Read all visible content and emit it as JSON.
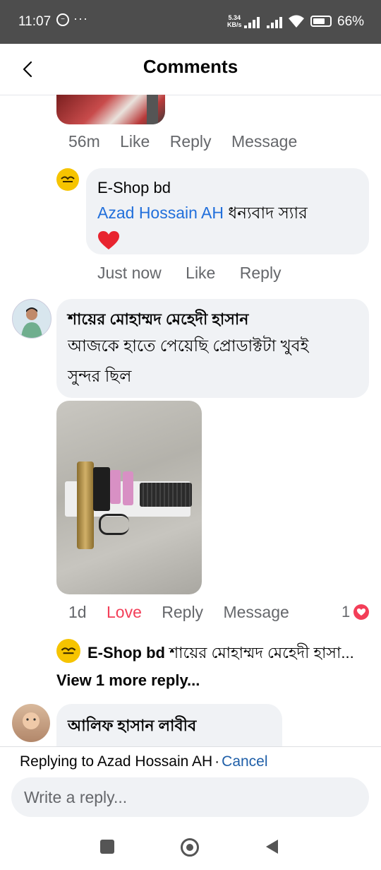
{
  "status_bar": {
    "time": "11:07",
    "speed_value": "5.34",
    "speed_unit": "KB/s",
    "battery": "66%"
  },
  "header": {
    "title": "Comments",
    "back_icon": "chevron-left-icon"
  },
  "comment1": {
    "time": "56m",
    "like": "Like",
    "reply": "Reply",
    "message": "Message"
  },
  "reply1": {
    "author": "E-Shop bd",
    "mention": "Azad Hossain AH",
    "text": "ধন্যবাদ স্যার",
    "emoji": "heart-icon",
    "time": "Just now",
    "like": "Like",
    "reply": "Reply"
  },
  "comment2": {
    "author": "শায়ের মোহাম্মদ মেহেদী হাসান",
    "text_line1": "আজকে হাতে পেয়েছি প্রোডাক্টটা খুবই",
    "text_line2": "সুন্দর ছিল",
    "time": "1d",
    "reaction_label": "Love",
    "reply": "Reply",
    "message": "Message",
    "reaction_count": "1",
    "reaction_icon": "love-reaction-icon",
    "reply_preview_author": "E-Shop bd",
    "reply_preview_text": "শায়ের মোহাম্মদ মেহেদী হাসা...",
    "view_more": "View 1 more reply..."
  },
  "comment3": {
    "author": "আলিফ হাসান লাবীব"
  },
  "reply_box": {
    "replying_to": "Replying to Azad Hossain AH",
    "separator": "·",
    "cancel": "Cancel",
    "placeholder": "Write a reply..."
  },
  "colors": {
    "love": "#f33e58",
    "link": "#216fdb",
    "meta": "#65676b",
    "bubble": "#f0f2f5",
    "statusbar": "#4d4d4d"
  }
}
